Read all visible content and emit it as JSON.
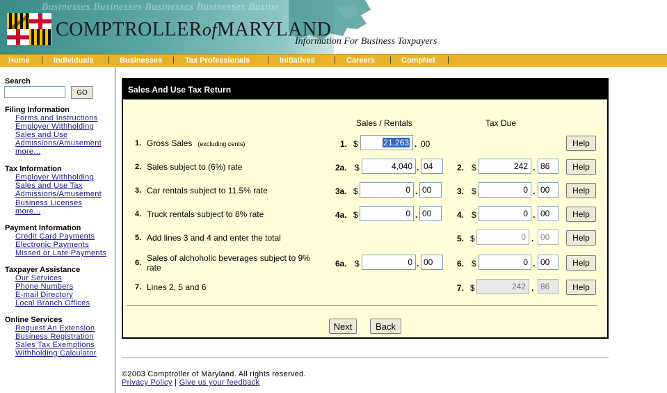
{
  "header": {
    "watermark": "Businesses  Businesses  Businesses  Businesses  Busine",
    "title_part1": "COMPTROLLER",
    "title_of": "of",
    "title_part2": "MARYLAND",
    "subtitle": "Information For Business Taxpayers"
  },
  "nav": {
    "items": [
      "Home",
      "Individuals",
      "Businesses",
      "Tax Professionals",
      "Initiatives",
      "Careers",
      "CompNet"
    ],
    "separator": "|"
  },
  "sidebar": {
    "search_label": "Search",
    "search_value": "",
    "go_label": "GO",
    "sections": [
      {
        "title": "Filing Information",
        "links": [
          "Forms and Instructions",
          "Employer Withholding",
          "Sales and Use",
          "Admissions/Amusement",
          "more..."
        ]
      },
      {
        "title": "Tax Information",
        "links": [
          "Employer Withholding",
          "Sales and Use Tax",
          "Admissions/Amusement",
          "Business Licenses",
          "more..."
        ]
      },
      {
        "title": "Payment Information",
        "links": [
          "Credit Card Payments",
          "Electronic Payments",
          "Missed or Late Payments"
        ]
      },
      {
        "title": "Taxpayer Assistance",
        "links": [
          "Our Services",
          "Phone Numbers",
          "E-mail Directory",
          "Local Branch Offices"
        ]
      },
      {
        "title": "Online Services",
        "links": [
          "Request An Extension",
          "Business Registration",
          "Sales Tax Exemptions",
          "Withholding Calculator"
        ]
      }
    ]
  },
  "form": {
    "title": "Sales And Use Tax Return",
    "col_sales": "Sales / Rentals",
    "col_tax": "Tax Due",
    "currency": "$",
    "decimal": ".",
    "help_label": "Help",
    "rows": [
      {
        "num": "1.",
        "label": "Gross Sales",
        "note": "(excluding cents)",
        "sales_code": "1.",
        "sales_dollars": "21,263",
        "sales_cents": "00",
        "tax_code": "",
        "tax_dollars": "",
        "tax_cents": ""
      },
      {
        "num": "2.",
        "label": "Sales subject to (6%) rate",
        "note": "",
        "sales_code": "2a.",
        "sales_dollars": "4,040",
        "sales_cents": "04",
        "tax_code": "2.",
        "tax_dollars": "242",
        "tax_cents": "86"
      },
      {
        "num": "3.",
        "label": "Car rentals subject to 11.5% rate",
        "note": "",
        "sales_code": "3a.",
        "sales_dollars": "0",
        "sales_cents": "00",
        "tax_code": "3.",
        "tax_dollars": "0",
        "tax_cents": "00"
      },
      {
        "num": "4.",
        "label": "Truck rentals subject to 8% rate",
        "note": "",
        "sales_code": "4a.",
        "sales_dollars": "0",
        "sales_cents": "00",
        "tax_code": "4.",
        "tax_dollars": "0",
        "tax_cents": "00"
      },
      {
        "num": "5.",
        "label": "Add lines 3 and 4 and enter the total",
        "note": "",
        "sales_code": "",
        "sales_dollars": "",
        "sales_cents": "",
        "tax_code": "5.",
        "tax_dollars": "0",
        "tax_cents": "00"
      },
      {
        "num": "6.",
        "label": "Sales of alchoholic beverages subject to 9% rate",
        "note": "",
        "sales_code": "6a.",
        "sales_dollars": "0",
        "sales_cents": "00",
        "tax_code": "6.",
        "tax_dollars": "0",
        "tax_cents": "00"
      },
      {
        "num": "7.",
        "label": "Lines 2, 5 and 6",
        "note": "",
        "sales_code": "",
        "sales_dollars": "",
        "sales_cents": "",
        "tax_code": "7.",
        "tax_dollars": "242",
        "tax_cents": "86"
      }
    ],
    "next_label": "Next",
    "back_label": "Back"
  },
  "footer": {
    "copyright": "©2003 Comptroller of Maryland. All rights reserved.",
    "privacy_label": "Privacy Policy",
    "separator": "|",
    "feedback_label": "Give us your feedback"
  },
  "colors": {
    "nav_bar": "#e8b32a",
    "banner_teal": "#3d8c8a",
    "panel_bg": "#fffed8",
    "link": "#1a1a8c"
  }
}
